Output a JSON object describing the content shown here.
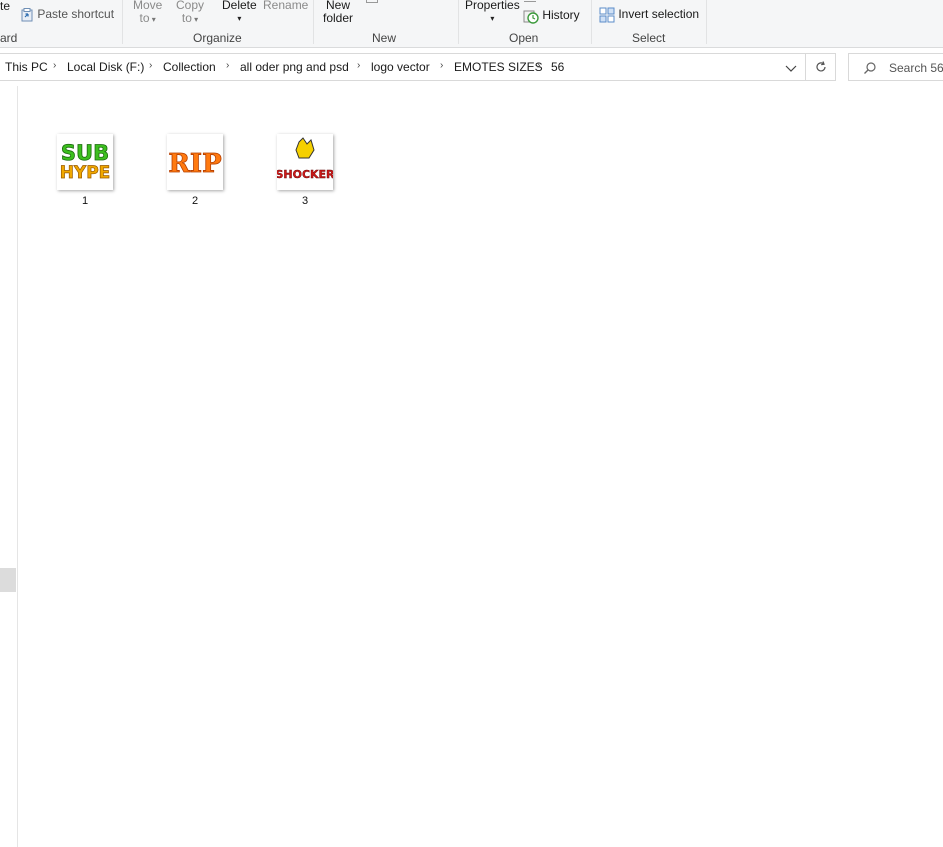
{
  "ribbon": {
    "clipboard": {
      "cut_label_partial": "te",
      "paste_shortcut": "Paste shortcut",
      "group_label_partial": "ard"
    },
    "organize": {
      "move_to": [
        "Move",
        "to"
      ],
      "copy_to": [
        "Copy",
        "to"
      ],
      "delete": "Delete",
      "rename": "Rename",
      "group_label": "Organize"
    },
    "new": {
      "new_folder": [
        "New",
        "folder"
      ],
      "group_label": "New"
    },
    "open": {
      "properties": "Properties",
      "history": "History",
      "group_label": "Open"
    },
    "select": {
      "invert_selection": "Invert selection",
      "group_label": "Select"
    }
  },
  "address": {
    "crumbs": [
      "This PC",
      "Local Disk (F:)",
      "Collection",
      "all oder png and psd",
      "logo vector",
      "EMOTES SIZES",
      "56"
    ]
  },
  "search": {
    "placeholder": "Search 56"
  },
  "files": [
    {
      "name": "1",
      "thumb_text": [
        "SUB",
        "HYPE"
      ],
      "thumb_colors": [
        "#3cbf1e",
        "#f0a800"
      ]
    },
    {
      "name": "2",
      "thumb_text": [
        "RIP"
      ],
      "thumb_colors": [
        "#ff7a10"
      ]
    },
    {
      "name": "3",
      "thumb_text": [
        "SHOCKER"
      ],
      "thumb_colors": [
        "#d01818",
        "#f5d000"
      ]
    }
  ],
  "icons": [
    "paste-shortcut-icon",
    "history-icon",
    "invert-selection-icon",
    "chevron-down-icon",
    "refresh-icon",
    "search-icon",
    "breadcrumb-separator-icon"
  ]
}
